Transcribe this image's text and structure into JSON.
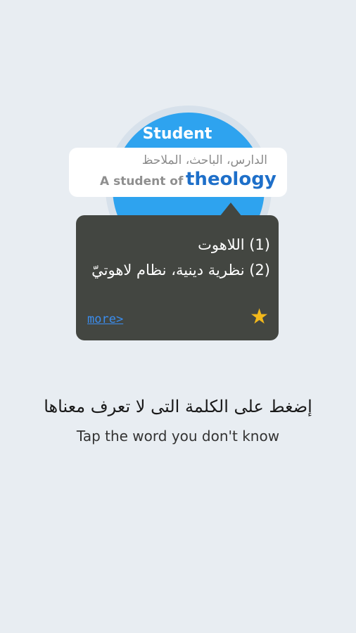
{
  "illustration": {
    "circle_title": "Student",
    "card": {
      "arabic_meaning": "الدارس، الباحث، الملاحظ",
      "phrase_prefix": "A student of",
      "highlighted_word": "theology"
    }
  },
  "popup": {
    "definitions": [
      "(1) اللاهوت",
      "(2) نظرية دينية، نظام لاهوتيّ"
    ],
    "more_label": "more>",
    "star_icon": "star-icon"
  },
  "instructions": {
    "arabic": "إضغط على الكلمة التى لا تعرف معناها",
    "english": "Tap the word you don't know"
  },
  "colors": {
    "background": "#e8edf2",
    "accent_blue": "#2ea3ef",
    "word_blue": "#1e6fc9",
    "popup_bg": "#434641",
    "star": "#f2b81b"
  }
}
